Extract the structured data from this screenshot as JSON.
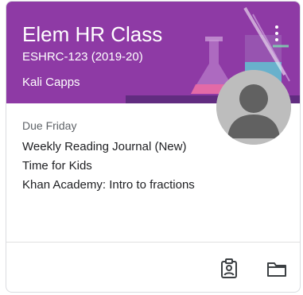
{
  "card": {
    "title": "Elem HR Class",
    "section": "ESHRC-123 (2019-20)",
    "teacher": "Kali Capps",
    "header_color": "#8e3aa5",
    "menu_icon": "more-vert-icon",
    "avatar_icon": "default-person-avatar"
  },
  "upcoming": {
    "due_label": "Due Friday",
    "assignments": [
      "Weekly Reading Journal (New)",
      "Time for Kids",
      "Khan Academy: Intro to fractions"
    ]
  },
  "footer": {
    "icons": [
      "assignment-ind-icon",
      "folder-icon"
    ]
  }
}
